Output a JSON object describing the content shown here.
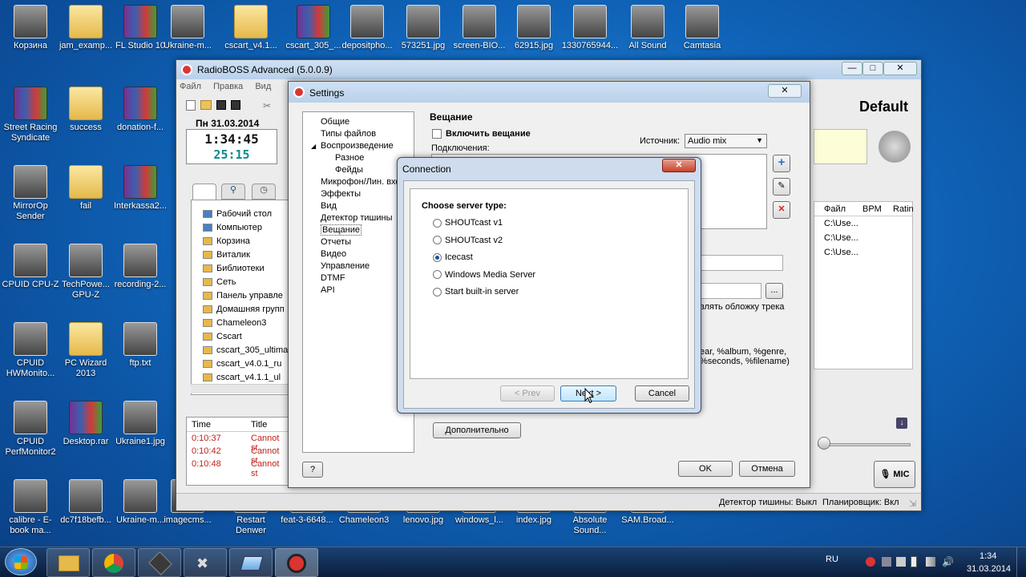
{
  "desktop": {
    "icons": [
      {
        "label": "Корзина"
      },
      {
        "label": "jam_examp..."
      },
      {
        "label": "FL Studio 10"
      },
      {
        "label": "Ukraine-m..."
      },
      {
        "label": "cscart_v4.1..."
      },
      {
        "label": "cscart_305_..."
      },
      {
        "label": "depositpho..."
      },
      {
        "label": "573251.jpg"
      },
      {
        "label": "screen-BIO..."
      },
      {
        "label": "62915.jpg"
      },
      {
        "label": "1330765944..."
      },
      {
        "label": "All Sound"
      },
      {
        "label": "Camtasia"
      },
      {
        "label": "Street Racing Syndicate"
      },
      {
        "label": "success"
      },
      {
        "label": "donation-f..."
      },
      {
        "label": "MirrorOp Sender"
      },
      {
        "label": "fail"
      },
      {
        "label": "Interkassa2..."
      },
      {
        "label": "CPUID CPU-Z"
      },
      {
        "label": "TechPowe... GPU-Z"
      },
      {
        "label": "recording-2..."
      },
      {
        "label": "CPUID HWMonito..."
      },
      {
        "label": "PC Wizard 2013"
      },
      {
        "label": "ftp.txt"
      },
      {
        "label": "CPUID PerfMonitor2"
      },
      {
        "label": "Desktop.rar"
      },
      {
        "label": "Ukraine1.jpg"
      },
      {
        "label": "calibre - E-book ma..."
      },
      {
        "label": "dc7f18befb..."
      },
      {
        "label": "Ukraine-m..."
      },
      {
        "label": "imagecms..."
      },
      {
        "label": "Restart Denwer"
      },
      {
        "label": "feat-3-6648..."
      },
      {
        "label": "Chameleon3"
      },
      {
        "label": "lenovo.jpg"
      },
      {
        "label": "windows_l..."
      },
      {
        "label": "index.jpg"
      },
      {
        "label": "Absolute Sound..."
      },
      {
        "label": "SAM.Broad..."
      }
    ]
  },
  "radioboss": {
    "title": "RadioBOSS Advanced (5.0.0.9)",
    "menu": [
      "Файл",
      "Правка",
      "Вид"
    ],
    "date": "Пн 31.03.2014",
    "time": "1:34:45",
    "elapsed": "25:15",
    "profile": "Default",
    "tree": [
      "Рабочий стол",
      "Компьютер",
      "Корзина",
      "Виталик",
      "Библиотеки",
      "Сеть",
      "Панель управле",
      "Домашняя групп",
      "Chameleon3",
      "Cscart",
      "cscart_305_ultima",
      "cscart_v4.0.1_ru",
      "cscart_v4.1.1_ul"
    ],
    "log_cols": [
      "Time",
      "Title"
    ],
    "log_rows": [
      {
        "time": "0:10:37",
        "title": "Cannot st"
      },
      {
        "time": "0:10:42",
        "title": "Cannot st"
      },
      {
        "time": "0:10:48",
        "title": "Cannot st"
      }
    ],
    "playlist_cols": [
      "Файл",
      "BPM",
      "Ratin"
    ],
    "playlist_rows": [
      "C:\\Use...",
      "C:\\Use...",
      "C:\\Use..."
    ],
    "status_silence": "Детектор тишины: Выкл",
    "status_scheduler": "Планировщик: Вкл",
    "mic_label": "MIC"
  },
  "settings": {
    "title": "Settings",
    "nav": [
      {
        "label": "Общие",
        "level": 0
      },
      {
        "label": "Типы файлов",
        "level": 0
      },
      {
        "label": "Воспроизведение",
        "level": 0
      },
      {
        "label": "Разное",
        "level": 1
      },
      {
        "label": "Фейды",
        "level": 1
      },
      {
        "label": "Микрофон/Лин. вход",
        "level": 0
      },
      {
        "label": "Эффекты",
        "level": 0
      },
      {
        "label": "Вид",
        "level": 0
      },
      {
        "label": "Детектор тишины",
        "level": 0
      },
      {
        "label": "Вещание",
        "level": 0
      },
      {
        "label": "Отчеты",
        "level": 0
      },
      {
        "label": "Видео",
        "level": 0
      },
      {
        "label": "Управление",
        "level": 0
      },
      {
        "label": "DTMF",
        "level": 0
      },
      {
        "label": "API",
        "level": 0
      }
    ],
    "section_title": "Вещание",
    "enable_label": "Включить вещание",
    "source_label": "Источник:",
    "source_value": "Audio mix",
    "connections_label": "Подключения:",
    "cover_text": "влять обложку трека",
    "tags_text_1": "ear, %album, %genre,",
    "tags_text_2": "%seconds, %filename)",
    "browse_label": "...",
    "advanced_button": "Дополнительно",
    "help_button": "?",
    "ok_button": "OK",
    "cancel_button": "Отмена"
  },
  "connection": {
    "title": "Connection",
    "prompt": "Choose server type:",
    "options": [
      {
        "label": "SHOUTcast v1",
        "selected": false
      },
      {
        "label": "SHOUTcast v2",
        "selected": false
      },
      {
        "label": "Icecast",
        "selected": true
      },
      {
        "label": "Windows Media Server",
        "selected": false
      },
      {
        "label": "Start built-in server",
        "selected": false
      }
    ],
    "prev_button": "< Prev",
    "next_button": "Next >",
    "cancel_button": "Cancel"
  },
  "taskbar": {
    "lang": "RU",
    "clock_time": "1:34",
    "clock_date": "31.03.2014"
  }
}
